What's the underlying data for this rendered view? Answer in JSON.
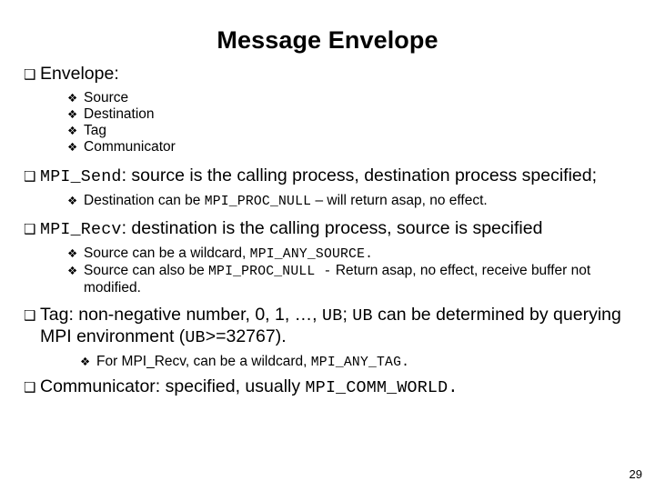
{
  "slide": {
    "title": "Message Envelope",
    "page_number": "29",
    "bullet_glyph_level1": "❑",
    "bullet_glyph_level2": "❖"
  },
  "envelope": {
    "heading": "Envelope:",
    "items": [
      "Source",
      "Destination",
      "Tag",
      "Communicator"
    ]
  },
  "send": {
    "api": "MPI_Send",
    "text": ": source is the calling process, destination process specified;",
    "sub": {
      "pre": "Destination can be ",
      "code": "MPI_PROC_NULL",
      "post": " – will return asap, no effect."
    }
  },
  "recv": {
    "api": "MPI_Recv",
    "text": ": destination is the calling process, source is specified",
    "sub1": {
      "pre": "Source can be a wildcard, ",
      "code": "MPI_ANY_SOURCE.",
      "post": ""
    },
    "sub2": {
      "pre": "Source can also be ",
      "code": "MPI_PROC_NULL -",
      "post": " Return asap, no effect, receive buffer not modified."
    }
  },
  "tag": {
    "part1": "Tag: non-negative number, 0, 1, …, ",
    "code1": "UB",
    "part2": "; ",
    "code2": "UB",
    "part3": " can be determined by querying MPI environment (",
    "code3": "UB",
    "part4": ">=32767).",
    "sub": {
      "pre": "For MPI_Recv, can be a wildcard, ",
      "code": "MPI_ANY_TAG.",
      "post": ""
    }
  },
  "communicator": {
    "pre": "Communicator: specified, usually ",
    "code": "MPI_COMM_WORLD.",
    "post": ""
  }
}
